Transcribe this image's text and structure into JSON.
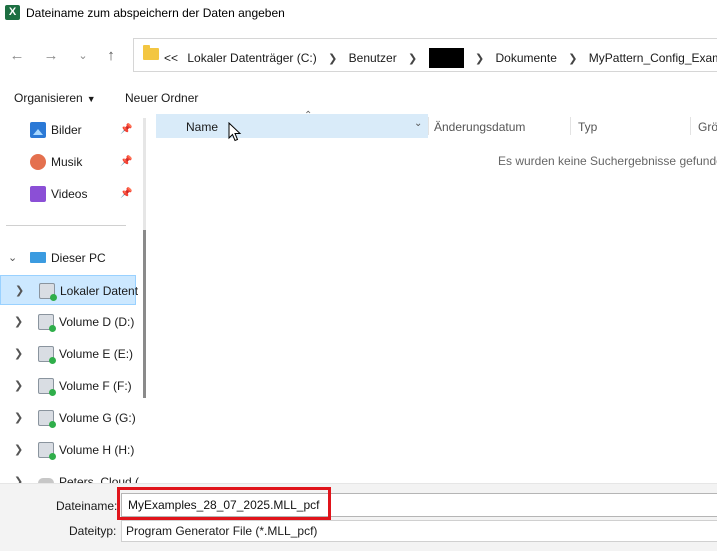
{
  "window": {
    "title": "Dateiname zum abspeichern der Daten angeben",
    "app_icon_letter": "X"
  },
  "address": {
    "overflow": "<<",
    "crumbs": [
      "Lokaler Datenträger (C:)",
      "Benutzer",
      "Dokumente",
      "MyPattern_Config_Examples"
    ]
  },
  "toolbar": {
    "organize_label": "Organisieren",
    "new_folder_label": "Neuer Ordner"
  },
  "sidebar": {
    "quick_access": [
      {
        "label": "Bilder",
        "icon": "pictures-icon"
      },
      {
        "label": "Musik",
        "icon": "music-icon"
      },
      {
        "label": "Videos",
        "icon": "videos-icon"
      }
    ],
    "this_pc_label": "Dieser PC",
    "drives": [
      {
        "label": "Lokaler Datent",
        "selected": true
      },
      {
        "label": "Volume D (D:)"
      },
      {
        "label": "Volume E (E:)"
      },
      {
        "label": "Volume F (F:)"
      },
      {
        "label": "Volume G (G:)"
      },
      {
        "label": "Volume H (H:)"
      },
      {
        "label": "Peters_Cloud ("
      }
    ]
  },
  "columns": {
    "name": "Name",
    "date": "Änderungsdatum",
    "type": "Typ",
    "size": "Grö"
  },
  "empty_message": "Es wurden keine Suchergebnisse gefunden.",
  "bottom": {
    "filename_label": "Dateiname:",
    "filename_value": "MyExamples_28_07_2025.MLL_pcf",
    "filetype_label": "Dateityp:",
    "filetype_value": "Program Generator File (*.MLL_pcf)"
  },
  "colors": {
    "selection": "#cce8ff",
    "highlight_box": "#e0141b",
    "folder": "#f3c642"
  }
}
